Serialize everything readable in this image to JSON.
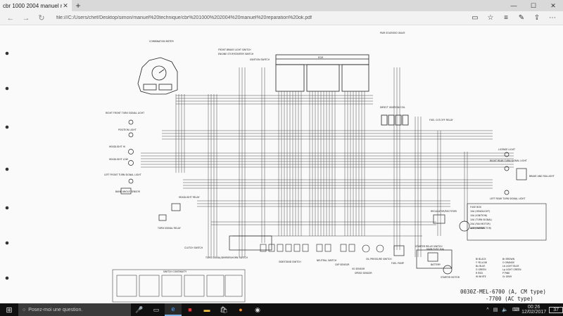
{
  "browser": {
    "tab_title": "cbr 1000 2004 manuel r",
    "url": "file:///C:/Users/chef/Desktop/simon/manuel%20technique/cbr%201000%202004%20manuel%20reparation%20ok.pdf",
    "window_controls": [
      "—",
      "☐",
      "✕"
    ]
  },
  "taskbar": {
    "search_placeholder": "Posez-moi une question.",
    "time": "00:26",
    "date": "12/02/2017",
    "notification_count": "37"
  },
  "diagram": {
    "top_labels": {
      "combination_meter": "COMBINATION METER",
      "ecm": "ECM",
      "pair_valve": "PAIR SOLENOID VALVE",
      "front_brake": "FRONT BRAKE LIGHT SWITCH",
      "engine_stop": "ENGINE STOP/STARTER SWITCH",
      "fuel_cut_relay": "FUEL CUT-OFF RELAY",
      "ignition_switch": "IGNITION SWITCH",
      "direct_ignition": "DIRECT IGNITION COIL"
    },
    "left_labels": {
      "right_front_turn": "RIGHT FRONT TURN SIGNAL LIGHT",
      "position_light": "POSITION LIGHT",
      "headlight_hi": "HEADLIGHT HI",
      "headlight_lo": "HEADLIGHT LOW",
      "left_front_turn": "LEFT FRONT TURN SIGNAL LIGHT",
      "bank_angle": "BANK ANGLE SENSOR",
      "headlight_relay": "HEADLIGHT RELAY",
      "turn_relay": "TURN SIGNAL RELAY",
      "clutch_switch": "CLUTCH SWITCH"
    },
    "right_labels": {
      "license_light": "LICENSE LIGHT",
      "right_rear_turn": "RIGHT REAR TURN SIGNAL LIGHT",
      "brake_tail": "BRAKE AND TAILLIGHT",
      "left_rear_turn": "LEFT REAR TURN SIGNAL LIGHT",
      "alternator": "ALTERNATOR",
      "regulator": "REGULATOR/RECTIFIER",
      "starter_relay": "STARTER RELAY SWITCH",
      "main_fuse": "MAIN FUSE 30A",
      "battery": "BATTERY",
      "starter_motor": "STARTER MOTOR",
      "fuel_pump": "FUEL PUMP"
    },
    "bottom_labels": {
      "switch_continuity": "SWITCH CONTINUITY",
      "turn_dimmer": "TURN SIGNAL/DIMMER/HORN SWITCH",
      "sidestand": "SIDESTAND SWITCH",
      "neutral": "NEUTRAL SWITCH",
      "ckp_sensor": "CKP SENSOR",
      "vs_sensor": "VS SENSOR",
      "oil_pressure": "OIL PRESSURE SWITCH",
      "speed_sensor": "SPEED SENSOR"
    },
    "fuse_box": {
      "title": "FUSE BOX",
      "lines": [
        "10A (HEADLIGHT)",
        "10A (IGNITION)",
        "10A (TURN SIGNAL)",
        "20A (FAN MOTOR)",
        "10A (CONNECTOR)"
      ]
    },
    "color_key": [
      "Bl BLACK",
      "Y YELLOW",
      "Bu BLUE",
      "G GREEN",
      "R RED",
      "W WHITE",
      "Br BROWN",
      "O ORANGE",
      "Lb LIGHT BLUE",
      "Lg LIGHT GREEN",
      "P PINK",
      "Gr GRAY"
    ],
    "code_line_1": "0030Z-MEL-6700 (A, CM type)",
    "code_line_2": "-7700 (AC type)"
  }
}
